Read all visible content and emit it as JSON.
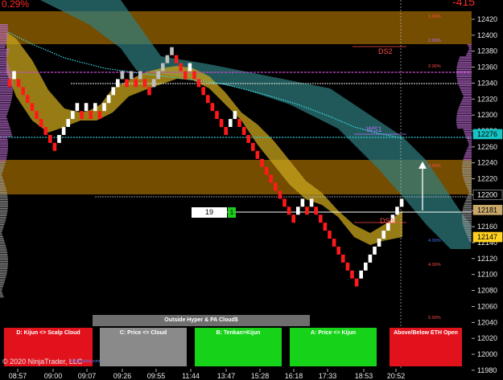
{
  "header": {
    "change_pct": "0.29%",
    "change_value": "-415"
  },
  "price_axis": {
    "labels": [
      "12420",
      "12400",
      "12380",
      "12360",
      "12340",
      "12320",
      "12300",
      "12280",
      "12260",
      "12240",
      "12220",
      "12200",
      "12180",
      "12160",
      "12140",
      "12120",
      "12100",
      "12080",
      "12060",
      "12040",
      "12020",
      "12000",
      "11980"
    ],
    "markers": [
      {
        "value": "12276",
        "bg": "#16c4c4",
        "fg": "#000000"
      },
      {
        "value": "12200",
        "bg": "#000000",
        "fg": "#ffffff"
      },
      {
        "value": "12181",
        "bg": "#c9a86a",
        "fg": "#000000"
      },
      {
        "value": "12147",
        "bg": "#ffd21f",
        "fg": "#000000"
      }
    ]
  },
  "time_axis": {
    "labels": [
      "08:57",
      "09:00",
      "09:07",
      "09:26",
      "09:55",
      "11:44",
      "13:47",
      "15:28",
      "16:18",
      "17:33",
      "18:53",
      "20:52"
    ]
  },
  "percent_labels": [
    {
      "text": "1.50%",
      "color": "#ff4d4d"
    },
    {
      "text": "2.00%",
      "color": "#b073ff"
    },
    {
      "text": "2.00%",
      "color": "#ff4d4d"
    },
    {
      "text": "3.00%",
      "color": "#ff4d4d"
    },
    {
      "text": "4.00%",
      "color": "#3a7dff"
    },
    {
      "text": "4.00%",
      "color": "#ff4d4d"
    },
    {
      "text": "5.00%",
      "color": "#ff4d4d"
    }
  ],
  "level_labels": {
    "ds2": "DS2",
    "ws1": "WS1",
    "ds3": "DS3"
  },
  "quantity": {
    "value": "19",
    "button": "1"
  },
  "banner": "Outside Hyper & PA Cloud$",
  "panels": [
    {
      "label": "D: Kijun <> Scalp Cloud",
      "color": "#e2121c"
    },
    {
      "label": "C: Price <> Cloud",
      "color": "#8a8a8a"
    },
    {
      "label": "B: Tenkan>Kijun",
      "color": "#16d31a"
    },
    {
      "label": "A: Price <> Kijun",
      "color": "#16d31a"
    },
    {
      "label": "Above/Below ETH Open",
      "color": "#e2121c"
    }
  ],
  "footer": {
    "copyright": "© 2020 NinjaTrader, LLC",
    "sub": "tlc@trading.com"
  },
  "colors": {
    "bull": "#ffffff",
    "bear": "#ff1a1a",
    "cloud_gold": "#c9a51e",
    "cloud_teal": "#2f7f80",
    "band_orange": "#8a5a00",
    "cyan_line": "#2cc9d6",
    "magenta_line": "#c24bd0"
  },
  "chart_data": {
    "type": "renko",
    "ylim": [
      11980,
      12430
    ],
    "ds2": 12375,
    "ws1": 12288,
    "ds3": 12176,
    "eth_open": 12200,
    "current": 12181,
    "band_top": [
      12397,
      12433
    ],
    "band_mid": [
      12203,
      12244
    ],
    "cyan_level": 12276,
    "magenta_level": 12359,
    "white_level": 12353,
    "white_level2": 12200,
    "bricks": [
      [
        1,
        12345,
        -1
      ],
      [
        2,
        12355,
        1
      ],
      [
        3,
        12345,
        -1
      ],
      [
        4,
        12335,
        -1
      ],
      [
        5,
        12325,
        -1
      ],
      [
        6,
        12315,
        -1
      ],
      [
        7,
        12305,
        -1
      ],
      [
        8,
        12295,
        -1
      ],
      [
        9,
        12285,
        -1
      ],
      [
        10,
        12275,
        -1
      ],
      [
        11,
        12265,
        -1
      ],
      [
        12,
        12275,
        1
      ],
      [
        13,
        12285,
        1
      ],
      [
        14,
        12295,
        1
      ],
      [
        15,
        12305,
        1
      ],
      [
        16,
        12315,
        1
      ],
      [
        17,
        12305,
        -1
      ],
      [
        18,
        12315,
        1
      ],
      [
        19,
        12305,
        -1
      ],
      [
        20,
        12315,
        1
      ],
      [
        21,
        12305,
        -1
      ],
      [
        22,
        12315,
        1
      ],
      [
        23,
        12325,
        1
      ],
      [
        24,
        12335,
        1
      ],
      [
        25,
        12345,
        1
      ],
      [
        26,
        12355,
        1
      ],
      [
        27,
        12345,
        -1
      ],
      [
        28,
        12355,
        1
      ],
      [
        29,
        12345,
        -1
      ],
      [
        30,
        12355,
        1
      ],
      [
        31,
        12345,
        -1
      ],
      [
        32,
        12335,
        -1
      ],
      [
        33,
        12345,
        1
      ],
      [
        34,
        12355,
        1
      ],
      [
        35,
        12365,
        1
      ],
      [
        36,
        12375,
        1
      ],
      [
        37,
        12385,
        1
      ],
      [
        38,
        12375,
        -1
      ],
      [
        39,
        12365,
        -1
      ],
      [
        40,
        12355,
        -1
      ],
      [
        41,
        12365,
        1
      ],
      [
        42,
        12355,
        -1
      ],
      [
        43,
        12345,
        -1
      ],
      [
        44,
        12335,
        -1
      ],
      [
        45,
        12325,
        -1
      ],
      [
        46,
        12315,
        -1
      ],
      [
        47,
        12305,
        -1
      ],
      [
        48,
        12295,
        -1
      ],
      [
        49,
        12285,
        -1
      ],
      [
        50,
        12295,
        1
      ],
      [
        51,
        12305,
        1
      ],
      [
        52,
        12295,
        -1
      ],
      [
        53,
        12285,
        -1
      ],
      [
        54,
        12275,
        -1
      ],
      [
        55,
        12265,
        -1
      ],
      [
        56,
        12255,
        -1
      ],
      [
        57,
        12245,
        -1
      ],
      [
        58,
        12235,
        -1
      ],
      [
        59,
        12225,
        -1
      ],
      [
        60,
        12215,
        -1
      ],
      [
        61,
        12205,
        -1
      ],
      [
        62,
        12195,
        -1
      ],
      [
        63,
        12185,
        -1
      ],
      [
        64,
        12175,
        -1
      ],
      [
        65,
        12185,
        1
      ],
      [
        66,
        12195,
        1
      ],
      [
        67,
        12185,
        -1
      ],
      [
        68,
        12195,
        1
      ],
      [
        69,
        12185,
        -1
      ],
      [
        70,
        12175,
        -1
      ],
      [
        71,
        12165,
        -1
      ],
      [
        72,
        12155,
        -1
      ],
      [
        73,
        12145,
        -1
      ],
      [
        74,
        12135,
        -1
      ],
      [
        75,
        12125,
        -1
      ],
      [
        76,
        12115,
        -1
      ],
      [
        77,
        12105,
        -1
      ],
      [
        78,
        12095,
        -1
      ],
      [
        79,
        12105,
        1
      ],
      [
        80,
        12115,
        1
      ],
      [
        81,
        12125,
        1
      ],
      [
        82,
        12135,
        1
      ],
      [
        83,
        12145,
        1
      ],
      [
        84,
        12155,
        1
      ],
      [
        85,
        12165,
        1
      ],
      [
        86,
        12175,
        1
      ],
      [
        87,
        12185,
        1
      ],
      [
        88,
        12195,
        1
      ]
    ]
  }
}
